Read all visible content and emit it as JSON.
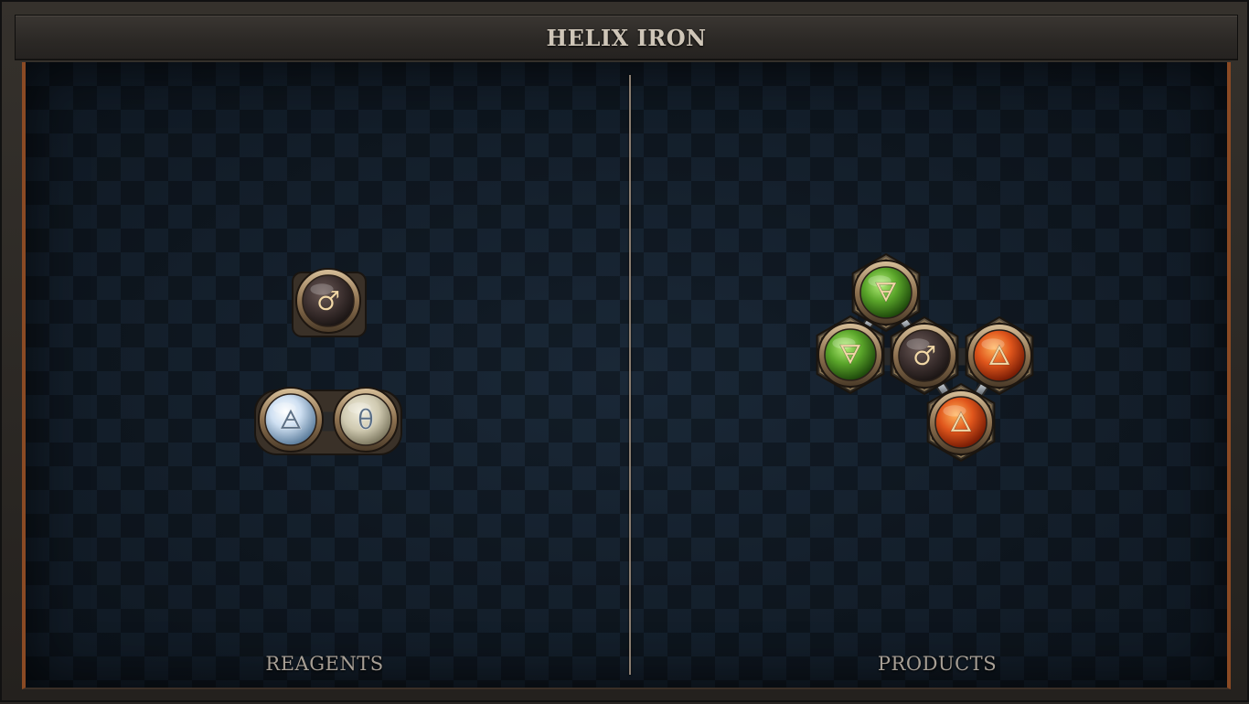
{
  "title": "HELIX IRON",
  "panels": {
    "reagents_label": "REAGENTS",
    "products_label": "PRODUCTS"
  },
  "atoms": {
    "iron": {
      "glyph": "♂",
      "element": "iron",
      "icon": "iron-symbol-icon",
      "color": "#3b2f2e"
    },
    "air": {
      "glyph": "🜁",
      "element": "air",
      "icon": "air-symbol-icon",
      "color": "#cfe0f2"
    },
    "salt": {
      "glyph": "θ",
      "element": "salt",
      "icon": "salt-symbol-icon",
      "color": "#cfc9b0"
    },
    "earth": {
      "glyph": "🜃",
      "element": "earth",
      "icon": "earth-symbol-icon",
      "color": "#5aa52a"
    },
    "fire": {
      "glyph": "🜂",
      "element": "fire",
      "icon": "fire-symbol-icon",
      "color": "#e0561c"
    }
  },
  "reagents": [
    {
      "name": "iron-reagent",
      "atoms": [
        "iron"
      ]
    },
    {
      "name": "air-salt-reagent",
      "atoms": [
        "air",
        "salt"
      ]
    }
  ],
  "product": {
    "name": "helix-iron-product",
    "atoms": [
      "earth",
      "earth",
      "iron",
      "fire",
      "fire"
    ]
  },
  "colors": {
    "frame_accent": "#8a4a24",
    "text": "#cfc6b8",
    "board": "#121d29"
  }
}
